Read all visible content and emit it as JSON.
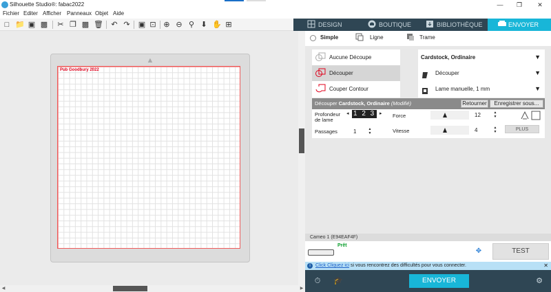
{
  "window": {
    "title": "Silhouette Studio®: fabac2022",
    "minimize": "—",
    "maximize": "❐",
    "close": "✕"
  },
  "menu": [
    "Fichier",
    "Editer",
    "Afficher",
    "Panneaux",
    "Objet",
    "Aide"
  ],
  "toolbar_icons": [
    "new-file-icon",
    "open-folder-icon",
    "save-icon",
    "print-icon",
    "cut-icon",
    "copy-icon",
    "paste-icon",
    "delete-icon",
    "undo-icon",
    "redo-icon",
    "group-icon",
    "ungroup-icon",
    "zoom-in-icon",
    "zoom-out-icon",
    "zoom-drag-icon",
    "move-down-icon",
    "pan-hand-icon",
    "fit-page-icon"
  ],
  "tabs": {
    "design": "DESIGN",
    "boutique": "BOUTIQUE",
    "bibliotheque": "BIBLIOTHÈQUE",
    "envoyer": "ENVOYER"
  },
  "canvas": {
    "design_text": "Pub Goodbury 2022"
  },
  "panel": {
    "modes": {
      "simple": "Simple",
      "ligne": "Ligne",
      "trame": "Trame"
    },
    "cut_modes": [
      "Aucune Découpe",
      "Découper",
      "Couper Contour"
    ],
    "selected_cut_mode": "Découper",
    "material": "Cardstock, Ordinaire",
    "action": "Découper",
    "tool": "Lame manuelle, 1 mm",
    "setting_bar": {
      "prefix": "Découper ",
      "material": "Cardstock, Ordinaire",
      "modified": " (Modifié)",
      "retourner": "Retourner",
      "enregistrer": "Enregistrer sous..."
    },
    "settings": {
      "profondeur_label": "Profondeur\nde lame",
      "profondeur_value": "1 2 3",
      "force_label": "Force",
      "force_value": "12",
      "force_level_pct": 38,
      "passages_label": "Passages",
      "passages_value": "1",
      "vitesse_label": "Vitesse",
      "vitesse_value": "4",
      "vitesse_level_pct": 38,
      "plus": "PLUS"
    },
    "device": {
      "name": "Cameo 1 (E94EAF4F)",
      "status": "Prêt",
      "test": "TEST"
    },
    "info": {
      "link": "Click Cliquez ici",
      "text": " si vous rencontrez des difficultés pour vous connecter.",
      "close": "✕"
    },
    "send": "ENVOYER"
  },
  "colors": {
    "tab_bar": "#2f4654",
    "accent": "#18b6d8",
    "design_text": "#e0001b",
    "ready": "#0a9e2c"
  }
}
